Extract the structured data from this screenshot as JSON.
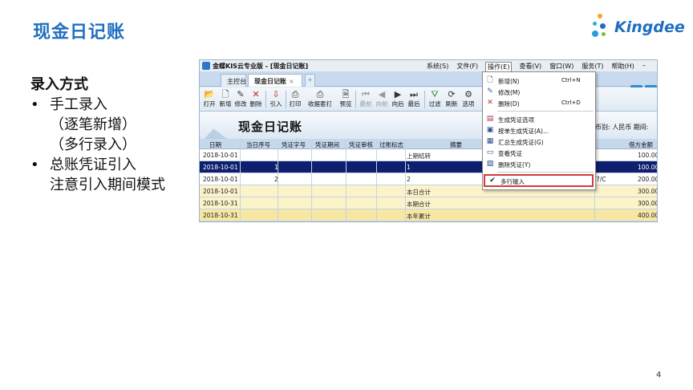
{
  "slide": {
    "title": "现金日记账",
    "page_number": "4",
    "logo_text": "Kingdee",
    "bullets": {
      "heading": "录入方式",
      "item1": "手工录入",
      "item1_sub1": "（逐笔新增）",
      "item1_sub2": "（多行录入）",
      "item2": "总账凭证引入",
      "item2_sub1": "注意引入期间模式",
      "bullet_char": "•"
    },
    "colors": {
      "title": "#1f6fc1",
      "selected_row": "#0d1f6e",
      "highlight_box": "#d63a3a"
    }
  },
  "app": {
    "window_title": "金蝶KIS云专业版 - [现金日记账]",
    "menubar": [
      "系统(S)",
      "文件(F)",
      "操作(E)",
      "查看(V)",
      "窗口(W)",
      "服务(T)",
      "帮助(H)",
      "–"
    ],
    "tabs": {
      "home": "主控台",
      "current": "现金日记账",
      "close": "×",
      "add": "+"
    },
    "toolbar": [
      {
        "label": "打开",
        "icon": "open-folder-icon",
        "glyph": "📂"
      },
      {
        "label": "新增",
        "icon": "new-doc-icon",
        "glyph": "🗋"
      },
      {
        "label": "修改",
        "icon": "edit-icon",
        "glyph": "✎"
      },
      {
        "label": "删除",
        "icon": "delete-icon",
        "glyph": "✕"
      },
      {
        "label": "引入",
        "icon": "import-icon",
        "glyph": "⇩"
      },
      {
        "label": "打印",
        "icon": "print-icon",
        "glyph": "⎙"
      },
      {
        "label": "收据套打",
        "icon": "receipt-print-icon",
        "glyph": "⎙"
      },
      {
        "label": "预览",
        "icon": "preview-icon",
        "glyph": "🗎"
      },
      {
        "label": "最前",
        "icon": "first-icon",
        "glyph": "⏮",
        "disabled": true
      },
      {
        "label": "向前",
        "icon": "prev-icon",
        "glyph": "◀",
        "disabled": true
      },
      {
        "label": "向后",
        "icon": "next-icon",
        "glyph": "▶"
      },
      {
        "label": "最后",
        "icon": "last-icon",
        "glyph": "⏭"
      },
      {
        "label": "过滤",
        "icon": "filter-icon",
        "glyph": "⛛"
      },
      {
        "label": "刷新",
        "icon": "refresh-icon",
        "glyph": "⟳"
      },
      {
        "label": "选项",
        "icon": "options-icon",
        "glyph": "⚙"
      }
    ],
    "ledger_title": "现金日记账",
    "currency_label": "币别: 人民币  期间:",
    "columns": [
      "日期",
      "当日序号",
      "凭证字号",
      "凭证期间",
      "凭证审核",
      "过账标志",
      "摘要",
      "借方金额"
    ],
    "rows": [
      {
        "date": "2018-10-01",
        "seq": "",
        "summary": "上期结转",
        "debit": "100.00",
        "extra": ""
      },
      {
        "date": "2018-10-01",
        "seq": "1",
        "summary": "1",
        "debit": "100.00",
        "extra": ""
      },
      {
        "date": "2018-10-01",
        "seq": "2",
        "summary": "2",
        "debit": "200.00",
        "extra": "7/C"
      },
      {
        "date": "2018-10-01",
        "seq": "",
        "summary": "本日合计",
        "debit": "300.00",
        "extra": ""
      },
      {
        "date": "2018-10-31",
        "seq": "",
        "summary": "本期合计",
        "debit": "300.00",
        "extra": ""
      },
      {
        "date": "2018-10-31",
        "seq": "",
        "summary": "本年累计",
        "debit": "400.00",
        "extra": ""
      }
    ],
    "dropdown": {
      "items": [
        {
          "label": "新增(N)",
          "shortcut": "Ctrl+N",
          "icon": "new-doc-icon",
          "glyph": "🗋"
        },
        {
          "label": "修改(M)",
          "shortcut": "",
          "icon": "edit-icon",
          "glyph": "✎"
        },
        {
          "label": "删除(D)",
          "shortcut": "Ctrl+D",
          "icon": "delete-icon",
          "glyph": "✕"
        },
        {
          "label": "生成凭证选项",
          "shortcut": "",
          "icon": "voucher-options-icon",
          "glyph": "▤"
        },
        {
          "label": "按单生成凭证(A)...",
          "shortcut": "",
          "icon": "single-voucher-icon",
          "glyph": "▣"
        },
        {
          "label": "汇总生成凭证(G)",
          "shortcut": "",
          "icon": "summary-voucher-icon",
          "glyph": "▦"
        },
        {
          "label": "查看凭证",
          "shortcut": "",
          "icon": "view-voucher-icon",
          "glyph": "▭"
        },
        {
          "label": "删除凭证(Y)",
          "shortcut": "",
          "icon": "delete-voucher-icon",
          "glyph": "▧"
        },
        {
          "label": "多行输入",
          "shortcut": "",
          "icon": "checkmark-icon",
          "glyph": "✔"
        }
      ]
    }
  }
}
